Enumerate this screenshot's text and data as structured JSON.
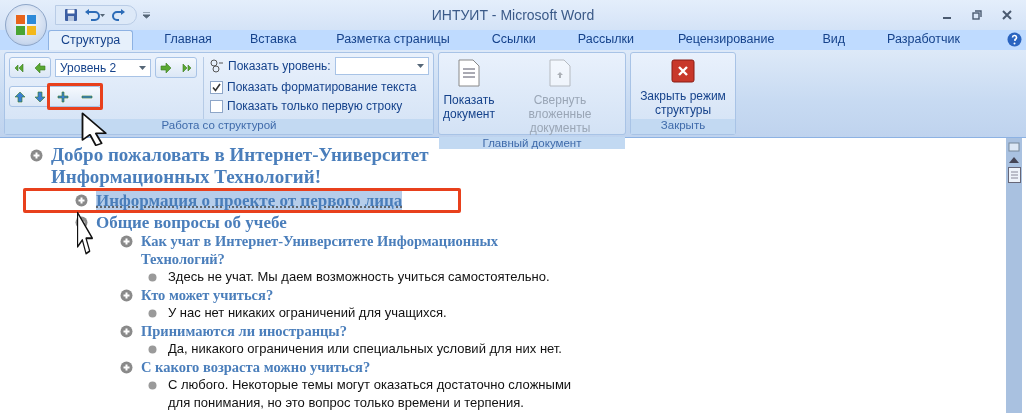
{
  "window": {
    "title": "ИНТУИТ - Microsoft Word"
  },
  "tabs": [
    {
      "label": "Структура",
      "selected": true
    },
    {
      "label": "Главная",
      "selected": false
    },
    {
      "label": "Вставка",
      "selected": false
    },
    {
      "label": "Разметка страницы",
      "selected": false
    },
    {
      "label": "Ссылки",
      "selected": false
    },
    {
      "label": "Рассылки",
      "selected": false
    },
    {
      "label": "Рецензирование",
      "selected": false
    },
    {
      "label": "Вид",
      "selected": false
    },
    {
      "label": "Разработчик",
      "selected": false
    }
  ],
  "ribbon": {
    "outline_group": {
      "label": "Работа со структурой",
      "level_dropdown": {
        "value": "Уровень 2"
      },
      "show_level": {
        "label": "Показать уровень:"
      },
      "checkboxes": [
        {
          "label": "Показать форматирование текста",
          "checked": true
        },
        {
          "label": "Показать только первую строку",
          "checked": false
        }
      ]
    },
    "master_group": {
      "label": "Главный документ",
      "buttons": [
        {
          "label": "Показать документ",
          "disabled": false
        },
        {
          "label": "Свернуть вложенные документы",
          "disabled": true
        }
      ]
    },
    "close_group": {
      "label": "Закрыть",
      "button": {
        "label": "Закрыть режим структуры"
      }
    }
  },
  "outline": [
    {
      "kind": "heading",
      "text": "Добро пожаловать в Интернет-Университет Информационных Технологий!",
      "selected": false,
      "children": [
        {
          "kind": "heading",
          "text": "Информация о проекте от первого лица",
          "selected": true
        },
        {
          "kind": "heading",
          "text": "Общие вопросы об учебе",
          "selected": false,
          "children": [
            {
              "kind": "heading",
              "text": "Как учат в Интернет-Университете Информационных Технологий?",
              "selected": false,
              "children": [
                {
                  "kind": "body",
                  "text": "Здесь не учат. Мы даем возможность учиться самостоятельно.",
                  "selected": false
                }
              ]
            },
            {
              "kind": "heading",
              "text": "Кто может учиться?",
              "selected": false,
              "children": [
                {
                  "kind": "body",
                  "text": "У нас нет никаких ограничений для учащихся.",
                  "selected": false
                }
              ]
            },
            {
              "kind": "heading",
              "text": "Принимаются ли иностранцы?",
              "selected": false,
              "children": [
                {
                  "kind": "body",
                  "text": "Да, никакого ограничения или специальных условий для них нет.",
                  "selected": false
                }
              ]
            },
            {
              "kind": "heading",
              "text": "С какого возраста можно учиться?",
              "selected": false,
              "children": [
                {
                  "kind": "body",
                  "text": "С любого. Некоторые темы могут оказаться достаточно сложными для понимания, но это вопрос только времени и терпения.",
                  "selected": false
                }
              ]
            }
          ]
        }
      ]
    }
  ]
}
